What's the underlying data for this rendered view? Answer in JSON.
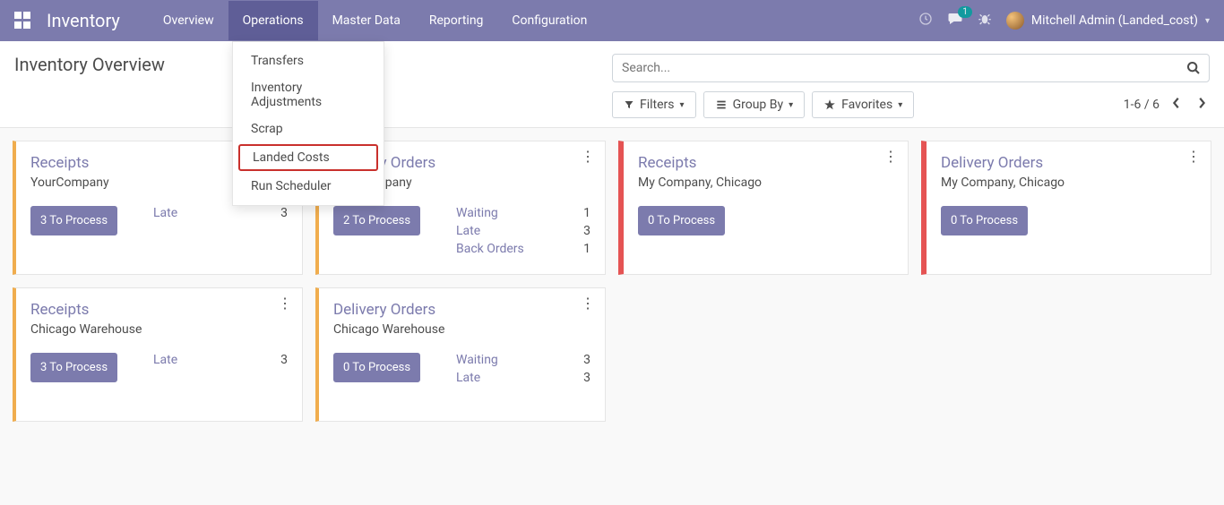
{
  "nav": {
    "brand": "Inventory",
    "items": [
      "Overview",
      "Operations",
      "Master Data",
      "Reporting",
      "Configuration"
    ],
    "active_index": 1,
    "chat_badge": "1",
    "user_name": "Mitchell Admin (Landed_cost)"
  },
  "dropdown": {
    "items": [
      "Transfers",
      "Inventory Adjustments",
      "Scrap",
      "Landed Costs",
      "Run Scheduler"
    ],
    "highlight_index": 3
  },
  "control_panel": {
    "title": "Inventory Overview",
    "search_placeholder": "Search...",
    "filters_label": "Filters",
    "groupby_label": "Group By",
    "favorites_label": "Favorites",
    "pager": "1-6 / 6"
  },
  "cards": [
    {
      "title": "Receipts",
      "subtitle": "YourCompany",
      "process": "3 To Process",
      "accent": "orange",
      "stats": [
        {
          "label": "Late",
          "value": "3"
        }
      ]
    },
    {
      "title": "Delivery Orders",
      "subtitle": "YourCompany",
      "process": "2 To Process",
      "accent": "orange",
      "stats": [
        {
          "label": "Waiting",
          "value": "1"
        },
        {
          "label": "Late",
          "value": "3"
        },
        {
          "label": "Back Orders",
          "value": "1"
        }
      ]
    },
    {
      "title": "Receipts",
      "subtitle": "My Company, Chicago",
      "process": "0 To Process",
      "accent": "red",
      "stats": []
    },
    {
      "title": "Delivery Orders",
      "subtitle": "My Company, Chicago",
      "process": "0 To Process",
      "accent": "red",
      "stats": []
    },
    {
      "title": "Receipts",
      "subtitle": "Chicago Warehouse",
      "process": "3 To Process",
      "accent": "orange",
      "stats": [
        {
          "label": "Late",
          "value": "3"
        }
      ]
    },
    {
      "title": "Delivery Orders",
      "subtitle": "Chicago Warehouse",
      "process": "0 To Process",
      "accent": "orange",
      "stats": [
        {
          "label": "Waiting",
          "value": "3"
        },
        {
          "label": "Late",
          "value": "3"
        }
      ]
    }
  ]
}
